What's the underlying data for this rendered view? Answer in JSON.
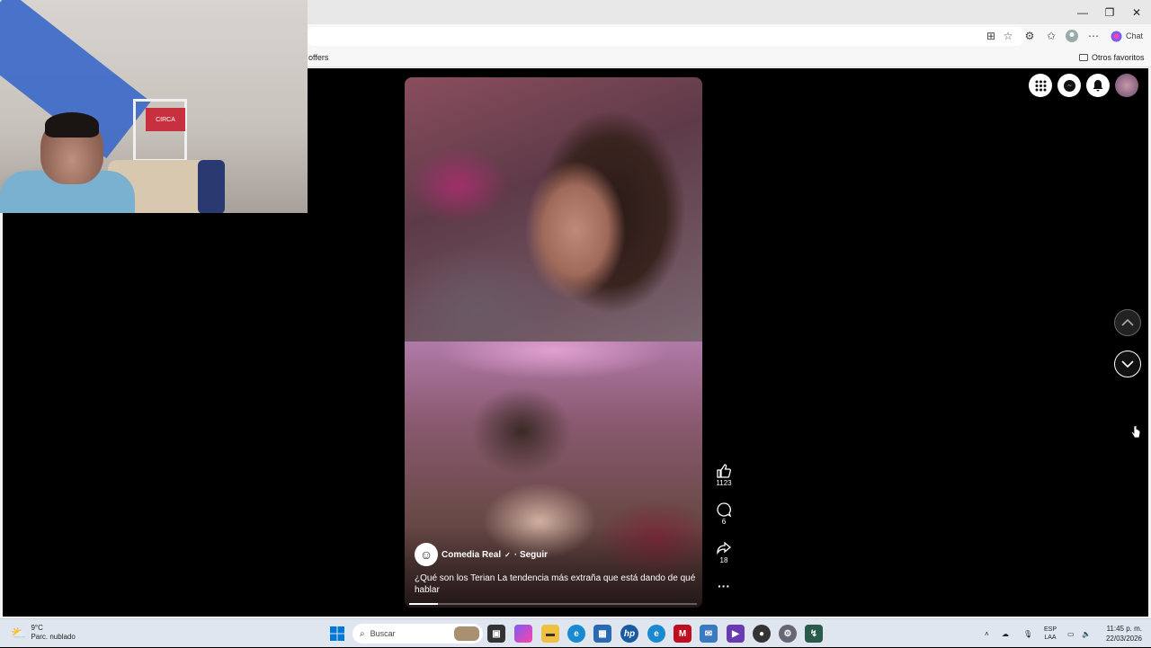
{
  "browser": {
    "window_controls": {
      "minimize": "—",
      "restore": "❐",
      "close": "✕"
    },
    "toolbar": {
      "chat_label": "Chat"
    },
    "favorites_bar": {
      "offers_label": "offers",
      "other_favorites_label": "Otros favoritos"
    }
  },
  "reel": {
    "author_name": "Comedia Real",
    "follow_label": "· Seguir",
    "caption": "¿Qué son los Terian  La tendencia más extraña que está dando de qué hablar",
    "progress": 0.1,
    "actions": {
      "likes": "1123",
      "comments": "6",
      "shares": "18"
    }
  },
  "webcam": {
    "box_label": "CIRCA"
  },
  "taskbar": {
    "weather_temp": "9°C",
    "weather_desc": "Parc. nublado",
    "search_placeholder": "Buscar",
    "lang_top": "ESP",
    "lang_bottom": "LAA",
    "time": "11:45 p. m.",
    "date": "22/03/2026"
  },
  "colors": {
    "page_bg": "#000000",
    "taskbar_bg": "#dfe6ef",
    "accent_edge": "#0078d4"
  }
}
